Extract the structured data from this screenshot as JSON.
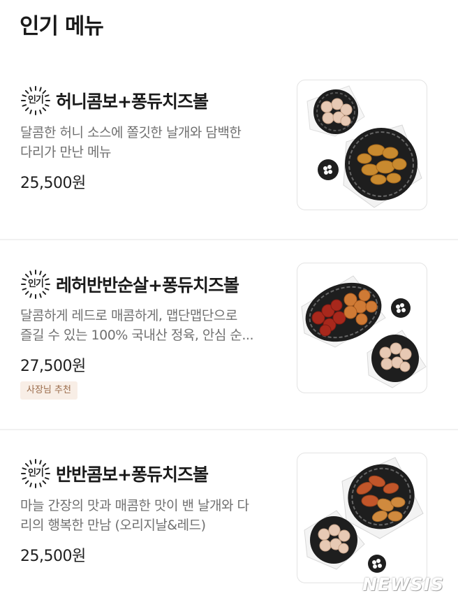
{
  "page": {
    "section_title": "인기 메뉴"
  },
  "badge_label": "인기",
  "items": [
    {
      "name": "허니콤보+퐁듀치즈볼",
      "desc_lines": [
        "달콤한 허니 소스에 쫄깃한 날개와 담백한",
        "다리가 만난 메뉴"
      ],
      "price": "25,500원",
      "tag": ""
    },
    {
      "name": "레허반반순살+퐁듀치즈볼",
      "desc_lines": [
        "달콤하게 레드로 매콤하게, 맵단맵단으로",
        "즐길 수 있는 100% 국내산 정육, 안심 순..."
      ],
      "price": "27,500원",
      "tag": "사장님 추천"
    },
    {
      "name": "반반콤보+퐁듀치즈볼",
      "desc_lines": [
        "마늘 간장의 맛과 매콤한 맛이 밴 날개와 다",
        "리의 행복한 만남 (오리지날&레드)"
      ],
      "price": "25,500원",
      "tag": ""
    }
  ],
  "watermark": "NEWSIS",
  "colors": {
    "tag_bg": "#f8eee6",
    "tag_text": "#9a6b4a",
    "desc_text": "#707070"
  }
}
